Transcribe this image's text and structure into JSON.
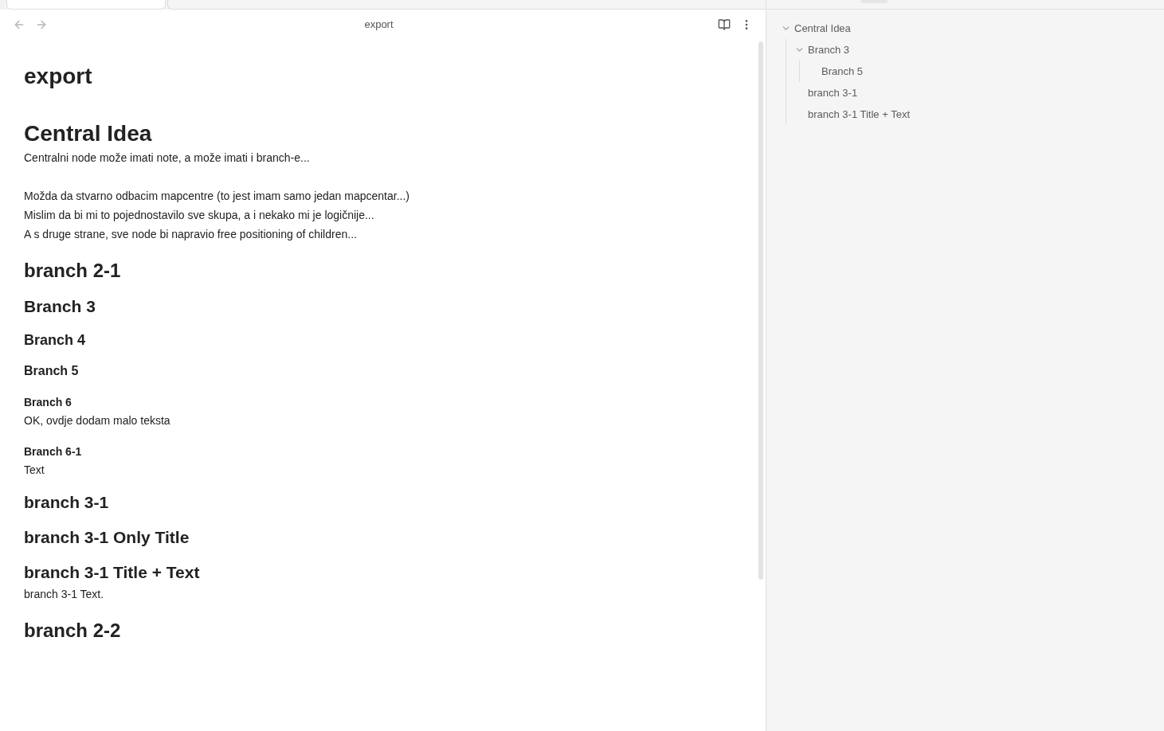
{
  "tabs": [
    {
      "selected": true
    },
    {
      "selected": false
    }
  ],
  "header": {
    "title": "export"
  },
  "document": [
    {
      "kind": "title",
      "text": "export"
    },
    {
      "kind": "h1",
      "text": "Central Idea"
    },
    {
      "kind": "paragraph",
      "lines": [
        "Centralni node može imati note, a može imati i branch-e..."
      ]
    },
    {
      "kind": "paragraph",
      "lines": [
        "Možda da stvarno odbacim mapcentre (to jest imam samo jedan mapcentar...)",
        "Mislim da bi mi to pojednostavilo sve skupa, a i nekako mi je logičnije...",
        "A s druge strane, sve node bi napravio free positioning of children..."
      ]
    },
    {
      "kind": "h2",
      "text": "branch 2-1"
    },
    {
      "kind": "h3",
      "text": "Branch 3"
    },
    {
      "kind": "h4",
      "text": "Branch 4"
    },
    {
      "kind": "h5",
      "text": "Branch 5"
    },
    {
      "kind": "h6",
      "text": "Branch 6"
    },
    {
      "kind": "paragraph",
      "lines": [
        "OK, ovdje dodam malo teksta"
      ]
    },
    {
      "kind": "h6",
      "text": "Branch 6-1"
    },
    {
      "kind": "paragraph",
      "lines": [
        "Text"
      ]
    },
    {
      "kind": "h3",
      "text": "branch 3-1"
    },
    {
      "kind": "h3",
      "text": "branch 3-1 Only Title"
    },
    {
      "kind": "h3",
      "text": "branch 3-1 Title + Text"
    },
    {
      "kind": "paragraph",
      "lines": [
        "branch 3-1 Text."
      ]
    },
    {
      "kind": "h2",
      "text": "branch 2-2"
    }
  ],
  "outline": [
    {
      "label": "Central Idea",
      "expanded": true,
      "children": [
        {
          "label": "Branch 3",
          "expanded": true,
          "children": [
            {
              "label": "Branch 5"
            }
          ]
        },
        {
          "label": "branch 3-1"
        },
        {
          "label": "branch 3-1 Title + Text"
        }
      ]
    }
  ]
}
